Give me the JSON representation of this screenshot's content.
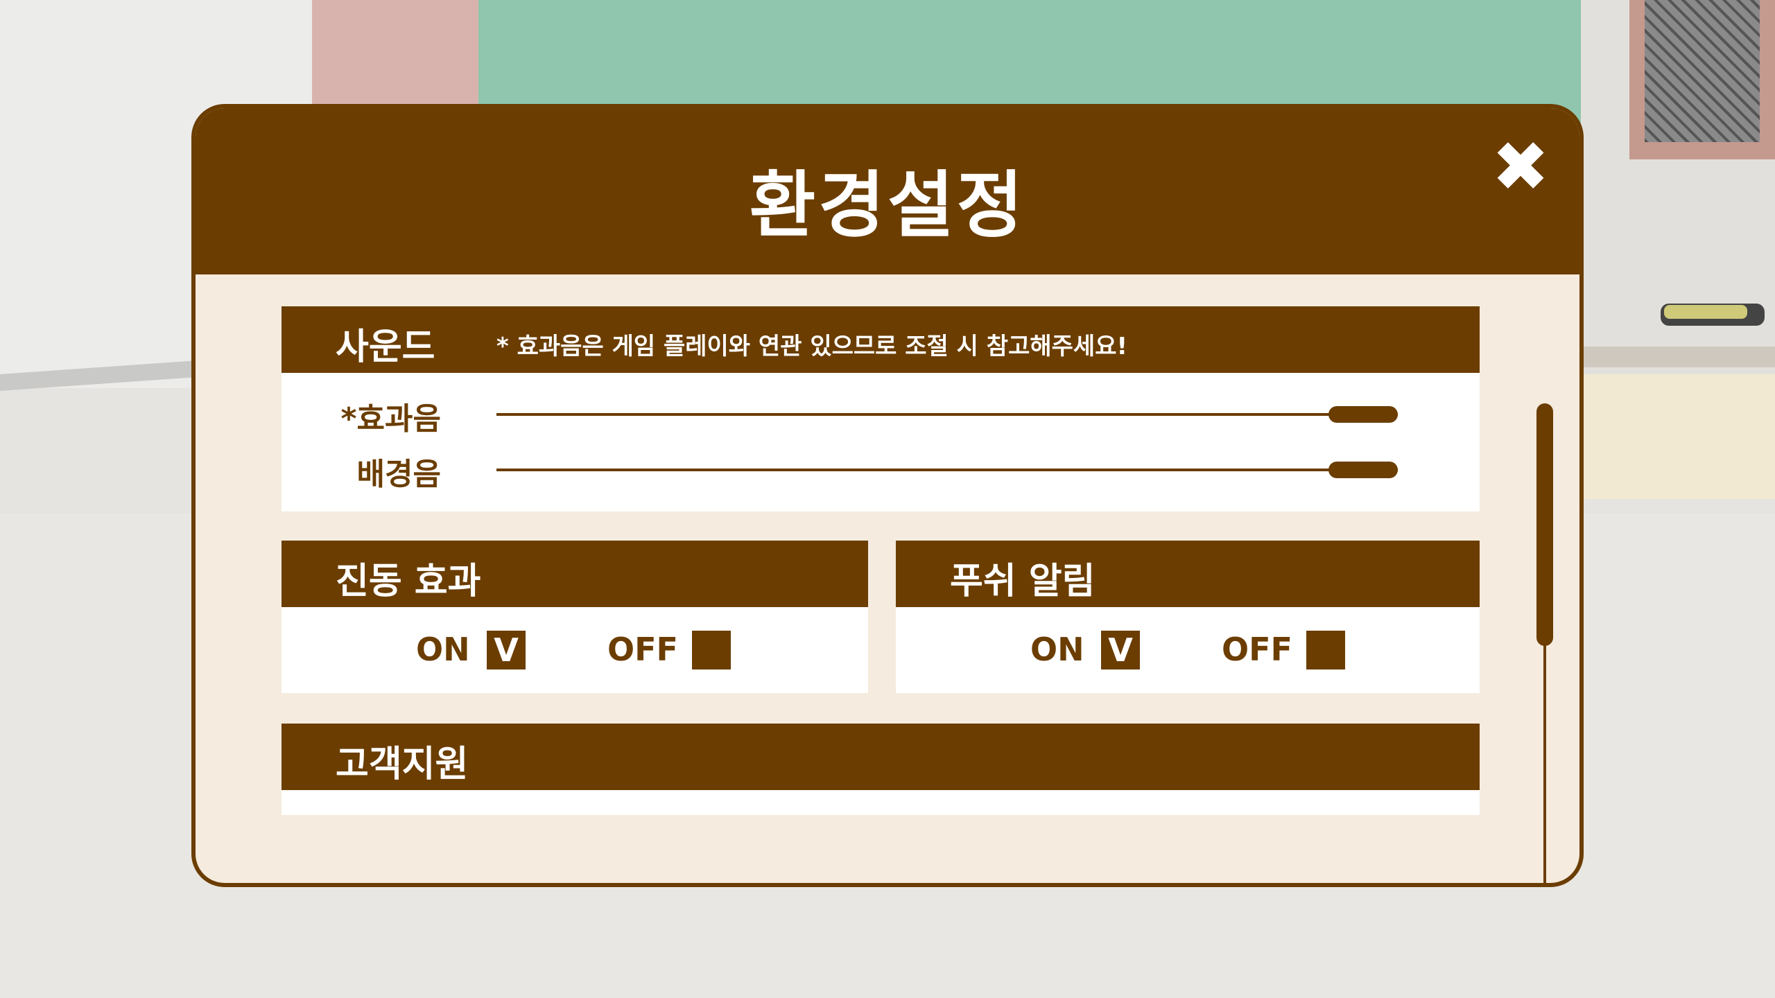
{
  "title": "환경설정",
  "close_icon": "close-icon",
  "sound": {
    "title": "사운드",
    "notice": "* 효과음은 게임 플레이와 연관 있으므로 조절 시 참고해주세요!",
    "sliders": [
      {
        "label": "*효과음",
        "value": 1.0
      },
      {
        "label": "배경음",
        "value": 1.0
      }
    ]
  },
  "vibration": {
    "title": "진동 효과",
    "on_label": "ON",
    "off_label": "OFF",
    "on_mark": "V",
    "off_mark": "",
    "selected": "ON"
  },
  "push": {
    "title": "푸쉬 알림",
    "on_label": "ON",
    "off_label": "OFF",
    "on_mark": "V",
    "off_mark": "",
    "selected": "ON"
  },
  "support": {
    "title": "고객지원"
  },
  "colors": {
    "primary": "#6b3d00",
    "panel_bg": "#f5ebde",
    "row_bg": "#ffffff",
    "text_light": "#ffffff"
  }
}
